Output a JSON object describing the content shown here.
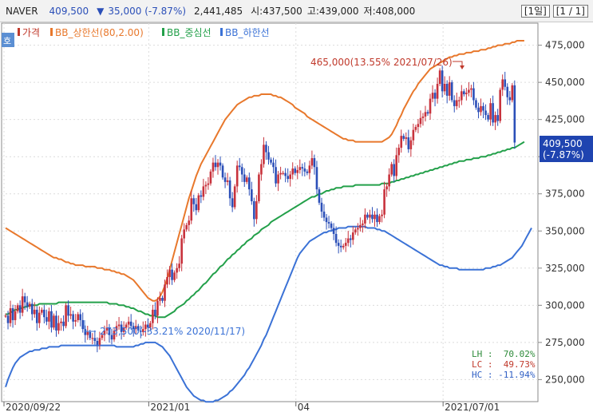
{
  "header": {
    "symbol": "NAVER",
    "price": "409,500",
    "change_arrow": "▼",
    "change": "35,000 (-7.87%)",
    "volume": "2,441,485",
    "open": "시:437,500",
    "high": "고:439,000",
    "low": "저:408,000",
    "period": "[1일]",
    "page": "[1 / 1]"
  },
  "legend": {
    "left_badge": "호",
    "items": [
      {
        "label": "가격",
        "color": "#c0392b"
      },
      {
        "label": "BB_상한선(80,2.00)",
        "color": "#e8782c"
      },
      {
        "label": "BB_중심선",
        "color": "#23a04a"
      },
      {
        "label": "BB_하한선",
        "color": "#3b72d6"
      }
    ]
  },
  "annotations": {
    "high": "465,000(13.55% 2021/07/26)",
    "low": "273,500(-33.21% 2020/11/17)"
  },
  "price_box": {
    "price": "409,500",
    "pct": "(-7.87%)"
  },
  "stats": [
    {
      "text": "LH :  70.02%",
      "color": "#2e8b3a"
    },
    {
      "text": "LC :  49.73%",
      "color": "#c0392b"
    },
    {
      "text": "HC : -11.94%",
      "color": "#2f5fc4"
    }
  ],
  "colors": {
    "up": "#c8323c",
    "down": "#2b4fb8",
    "upper": "#e8782c",
    "mid": "#23a04a",
    "lower": "#3b72d6"
  },
  "chart_data": {
    "type": "line",
    "x_ticks": [
      "2020/09/22",
      "2021/01",
      "04",
      "2021/07/01"
    ],
    "y_ticks": [
      "250,000",
      "275,000",
      "300,000",
      "325,000",
      "350,000",
      "375,000",
      "400,000",
      "425,000",
      "450,000",
      "475,000"
    ],
    "ylim": [
      240000,
      485000
    ],
    "n_bars": 220,
    "series": [
      {
        "name": "가격",
        "close": [
          293000,
          288000,
          298000,
          290000,
          296000,
          300000,
          295000,
          306000,
          302000,
          299000,
          301000,
          294000,
          297000,
          288000,
          295000,
          297000,
          292000,
          289000,
          296000,
          285000,
          293000,
          283000,
          288000,
          289000,
          286000,
          300000,
          293000,
          294000,
          289000,
          290000,
          294000,
          290000,
          284000,
          280000,
          282000,
          278000,
          278000,
          276000,
          273500,
          278000,
          280000,
          283000,
          285000,
          280000,
          277000,
          283000,
          286000,
          287000,
          282000,
          285000,
          287000,
          289000,
          286000,
          284000,
          286000,
          283000,
          282000,
          284000,
          287000,
          285000,
          288000,
          297000,
          293000,
          303000,
          305000,
          303000,
          314000,
          319000,
          324000,
          317000,
          322000,
          325000,
          328000,
          345000,
          351000,
          354000,
          357000,
          372000,
          368000,
          364000,
          374000,
          373000,
          380000,
          381000,
          382000,
          390000,
          396000,
          393000,
          396000,
          394000,
          386000,
          383000,
          384000,
          372000,
          366000,
          380000,
          394000,
          393000,
          388000,
          383000,
          386000,
          378000,
          370000,
          358000,
          370000,
          388000,
          395000,
          408000,
          403000,
          398000,
          396000,
          393000,
          382000,
          388000,
          389000,
          389000,
          387000,
          385000,
          388000,
          392000,
          389000,
          391000,
          393000,
          392000,
          390000,
          389000,
          394000,
          399000,
          393000,
          378000,
          369000,
          363000,
          359000,
          356000,
          355000,
          352000,
          348000,
          342000,
          340000,
          339000,
          340000,
          342000,
          345000,
          344000,
          349000,
          351000,
          352000,
          354000,
          355000,
          361000,
          359000,
          361000,
          358000,
          361000,
          356000,
          360000,
          361000,
          378000,
          380000,
          388000,
          395000,
          387000,
          401000,
          406000,
          414000,
          412000,
          413000,
          405000,
          411000,
          418000,
          420000,
          422000,
          426000,
          427000,
          430000,
          429000,
          439000,
          443000,
          439000,
          449000,
          458000,
          444000,
          449000,
          441000,
          450000,
          438000,
          434000,
          438000,
          438000,
          444000,
          442000,
          443000,
          445000,
          446000,
          438000,
          433000,
          430000,
          434000,
          431000,
          428000,
          425000,
          436000,
          423000,
          428000,
          424000,
          445000,
          452000,
          447000,
          440000,
          438000,
          448000,
          409500
        ]
      },
      {
        "name": "BB_상한선(80,2.00)",
        "values": [
          352000,
          351000,
          350000,
          349000,
          348000,
          347000,
          346000,
          345000,
          344000,
          343000,
          342000,
          341000,
          340000,
          339000,
          338000,
          337000,
          336000,
          335000,
          334000,
          333000,
          332000,
          332000,
          331000,
          331000,
          330000,
          329000,
          329000,
          328000,
          328000,
          327000,
          327000,
          327000,
          327000,
          326000,
          326000,
          326000,
          326000,
          326000,
          325000,
          325000,
          325000,
          324000,
          324000,
          324000,
          323000,
          323000,
          322000,
          322000,
          321000,
          321000,
          320000,
          319000,
          318000,
          317000,
          315000,
          313000,
          311000,
          309000,
          307000,
          305000,
          304000,
          303000,
          303000,
          304000,
          306000,
          309000,
          313000,
          318000,
          324000,
          330000,
          336000,
          342000,
          348000,
          354000,
          360000,
          366000,
          372000,
          377000,
          382000,
          387000,
          391000,
          395000,
          398000,
          401000,
          404000,
          407000,
          410000,
          413000,
          416000,
          419000,
          422000,
          425000,
          427000,
          429000,
          431000,
          433000,
          435000,
          436000,
          437000,
          438000,
          439000,
          440000,
          440000,
          441000,
          441000,
          441000,
          442000,
          442000,
          442000,
          442000,
          442000,
          441000,
          441000,
          440000,
          440000,
          439000,
          438000,
          437000,
          436000,
          435000,
          433000,
          432000,
          431000,
          430000,
          429000,
          427000,
          426000,
          425000,
          424000,
          423000,
          422000,
          421000,
          420000,
          419000,
          418000,
          417000,
          416000,
          415000,
          414000,
          413000,
          412000,
          412000,
          411000,
          411000,
          411000,
          410000,
          410000,
          410000,
          410000,
          410000,
          410000,
          410000,
          410000,
          410000,
          410000,
          410000,
          410000,
          411000,
          412000,
          413000,
          415000,
          418000,
          421000,
          425000,
          428000,
          432000,
          435000,
          438000,
          441000,
          444000,
          446000,
          449000,
          451000,
          453000,
          455000,
          457000,
          459000,
          460000,
          461000,
          462000,
          463000,
          464000,
          465000,
          466000,
          467000,
          467000,
          468000,
          468000,
          469000,
          469000,
          469000,
          470000,
          470000,
          470000,
          471000,
          471000,
          471000,
          472000,
          472000,
          472000,
          473000,
          473000,
          474000,
          474000,
          475000,
          475000,
          475000,
          476000,
          476000,
          476000,
          477000,
          477000,
          478000,
          478000,
          478000,
          478000
        ]
      },
      {
        "name": "BB_중심선",
        "values": [
          294000,
          294000,
          295000,
          296000,
          297000,
          297000,
          298000,
          298000,
          299000,
          299000,
          300000,
          300000,
          300000,
          300000,
          301000,
          301000,
          301000,
          301000,
          301000,
          301000,
          301000,
          301000,
          302000,
          302000,
          302000,
          302000,
          302000,
          302000,
          302000,
          302000,
          302000,
          302000,
          302000,
          302000,
          302000,
          302000,
          302000,
          302000,
          302000,
          302000,
          302000,
          302000,
          302000,
          301000,
          301000,
          301000,
          301000,
          300000,
          300000,
          300000,
          299000,
          299000,
          298000,
          298000,
          297000,
          296000,
          296000,
          295000,
          294000,
          294000,
          293000,
          293000,
          293000,
          292000,
          292000,
          292000,
          292000,
          293000,
          294000,
          295000,
          296000,
          298000,
          299000,
          300000,
          301000,
          303000,
          304000,
          306000,
          307000,
          309000,
          310000,
          312000,
          314000,
          315000,
          317000,
          319000,
          321000,
          322000,
          324000,
          326000,
          327000,
          329000,
          331000,
          332000,
          334000,
          335000,
          337000,
          338000,
          340000,
          341000,
          343000,
          344000,
          345000,
          347000,
          348000,
          349000,
          351000,
          352000,
          353000,
          354000,
          356000,
          357000,
          358000,
          359000,
          360000,
          361000,
          362000,
          363000,
          364000,
          365000,
          366000,
          367000,
          368000,
          369000,
          370000,
          371000,
          372000,
          373000,
          373000,
          374000,
          375000,
          375000,
          376000,
          377000,
          377000,
          378000,
          378000,
          379000,
          379000,
          379000,
          380000,
          380000,
          380000,
          380000,
          380000,
          381000,
          381000,
          381000,
          381000,
          381000,
          381000,
          381000,
          381000,
          381000,
          381000,
          381000,
          382000,
          382000,
          382000,
          382000,
          383000,
          383000,
          384000,
          384000,
          385000,
          385000,
          386000,
          386000,
          387000,
          387000,
          388000,
          388000,
          389000,
          389000,
          390000,
          390000,
          391000,
          391000,
          392000,
          392000,
          393000,
          393000,
          394000,
          394000,
          395000,
          395000,
          396000,
          396000,
          397000,
          397000,
          397000,
          398000,
          398000,
          398000,
          399000,
          399000,
          399000,
          400000,
          400000,
          400000,
          401000,
          401000,
          402000,
          402000,
          403000,
          403000,
          404000,
          404000,
          405000,
          405000,
          406000,
          406000,
          407000,
          408000,
          409000,
          410000
        ]
      },
      {
        "name": "BB_하한선",
        "values": [
          245000,
          250000,
          254000,
          258000,
          261000,
          263000,
          265000,
          266000,
          267000,
          268000,
          269000,
          269000,
          270000,
          270000,
          270000,
          271000,
          271000,
          271000,
          272000,
          272000,
          272000,
          272000,
          272000,
          273000,
          273000,
          273000,
          273000,
          273000,
          273000,
          273000,
          273000,
          273000,
          273000,
          273000,
          273000,
          273000,
          273000,
          273000,
          273000,
          273000,
          273000,
          273000,
          273000,
          273000,
          273000,
          273000,
          272000,
          272000,
          272000,
          272000,
          272000,
          272000,
          272000,
          272000,
          273000,
          273000,
          274000,
          274000,
          275000,
          275000,
          275000,
          275000,
          275000,
          274000,
          273000,
          272000,
          270000,
          268000,
          266000,
          263000,
          260000,
          257000,
          254000,
          251000,
          248000,
          245000,
          243000,
          241000,
          239000,
          238000,
          237000,
          236000,
          236000,
          235000,
          235000,
          235000,
          235000,
          236000,
          236000,
          237000,
          238000,
          239000,
          240000,
          242000,
          243000,
          245000,
          247000,
          249000,
          251000,
          253000,
          256000,
          258000,
          261000,
          264000,
          267000,
          270000,
          273000,
          277000,
          280000,
          284000,
          288000,
          292000,
          296000,
          300000,
          304000,
          308000,
          312000,
          316000,
          320000,
          324000,
          328000,
          332000,
          335000,
          337000,
          339000,
          341000,
          343000,
          344000,
          345000,
          346000,
          347000,
          348000,
          349000,
          349000,
          350000,
          350000,
          351000,
          351000,
          352000,
          352000,
          352000,
          352000,
          353000,
          353000,
          353000,
          353000,
          353000,
          353000,
          353000,
          353000,
          352000,
          352000,
          352000,
          352000,
          351000,
          351000,
          350000,
          350000,
          349000,
          348000,
          347000,
          346000,
          345000,
          344000,
          343000,
          342000,
          341000,
          340000,
          339000,
          338000,
          337000,
          336000,
          335000,
          334000,
          333000,
          332000,
          331000,
          330000,
          329000,
          328000,
          327000,
          327000,
          326000,
          326000,
          325000,
          325000,
          325000,
          325000,
          324000,
          324000,
          324000,
          324000,
          324000,
          324000,
          324000,
          324000,
          324000,
          324000,
          324000,
          325000,
          325000,
          325000,
          326000,
          326000,
          327000,
          327000,
          328000,
          329000,
          330000,
          331000,
          332000,
          334000,
          336000,
          338000,
          340000,
          343000,
          346000,
          349000,
          352000
        ]
      }
    ]
  }
}
